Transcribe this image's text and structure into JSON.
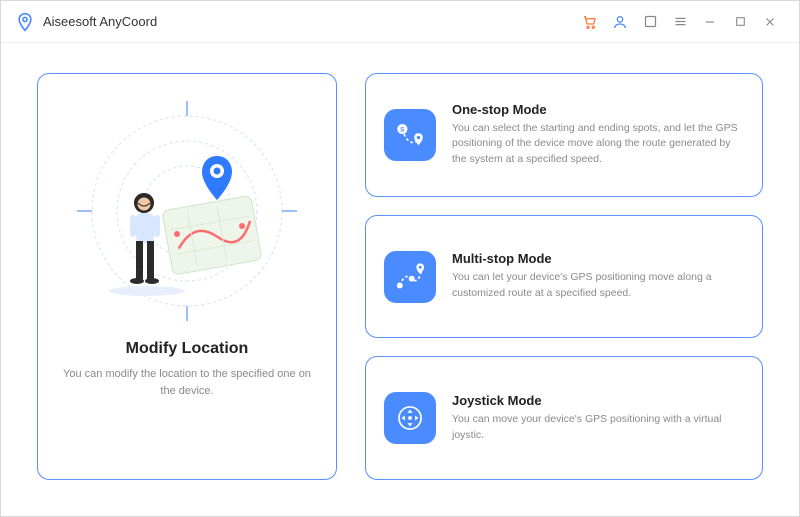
{
  "app": {
    "title": "Aiseesoft AnyCoord"
  },
  "main": {
    "modify": {
      "title": "Modify Location",
      "desc": "You can modify the location to the specified one on the device."
    },
    "modes": [
      {
        "title": "One-stop Mode",
        "desc": "You can select the starting and ending spots, and let the GPS positioning of the device move along the route generated by the system at a specified speed."
      },
      {
        "title": "Multi-stop Mode",
        "desc": "You can let your device's GPS positioning move along a customized route at a specified speed."
      },
      {
        "title": "Joystick Mode",
        "desc": "You can move your device's GPS positioning with a virtual joystic."
      }
    ]
  }
}
